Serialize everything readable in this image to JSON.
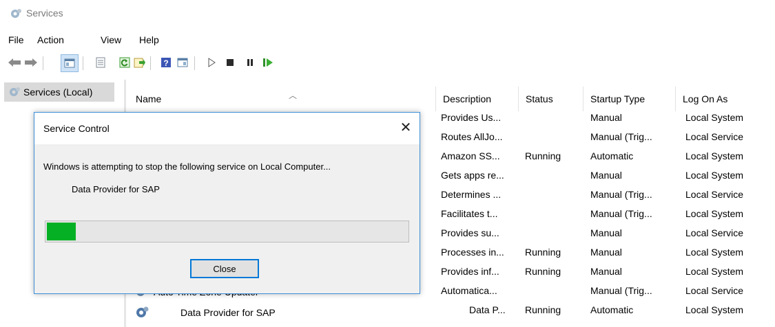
{
  "window": {
    "title": "Services"
  },
  "menu": [
    "File",
    "Action",
    "View",
    "Help"
  ],
  "tree": {
    "selected_label": "Services (Local)"
  },
  "columns": {
    "name": "Name",
    "description": "Description",
    "status": "Status",
    "startup": "Startup Type",
    "logon": "Log On As"
  },
  "rows": [
    {
      "description": "Provides Us...",
      "status": "",
      "startup": "Manual",
      "logon": "Local System"
    },
    {
      "description": "Routes AllJo...",
      "status": "",
      "startup": "Manual (Trig...",
      "logon": "Local Service"
    },
    {
      "description": "Amazon SS...",
      "status": "Running",
      "startup": "Automatic",
      "logon": "Local System"
    },
    {
      "description": "Gets apps re...",
      "status": "",
      "startup": "Manual",
      "logon": "Local System"
    },
    {
      "description": "Determines ...",
      "status": "",
      "startup": "Manual (Trig...",
      "logon": "Local Service"
    },
    {
      "description": "Facilitates t...",
      "status": "",
      "startup": "Manual (Trig...",
      "logon": "Local System"
    },
    {
      "description": "Provides su...",
      "status": "",
      "startup": "Manual",
      "logon": "Local Service"
    },
    {
      "description": "Processes in...",
      "status": "Running",
      "startup": "Manual",
      "logon": "Local System"
    },
    {
      "description": "Provides inf...",
      "status": "Running",
      "startup": "Manual",
      "logon": "Local System"
    },
    {
      "name": "Auto Time Zone Updater",
      "description": "Automatica...",
      "status": "",
      "startup": "Manual (Trig...",
      "logon": "Local Service"
    },
    {
      "name": "Data Provider for SAP",
      "description": "Data P...",
      "status": "Running",
      "startup": "Automatic",
      "logon": "Local System"
    }
  ],
  "dialog": {
    "title": "Service Control",
    "message": "Windows is attempting to stop the following service on Local Computer...",
    "service_name": "Data Provider for SAP",
    "progress": 0.08,
    "close_button": "Close",
    "close_glyph": "✕"
  },
  "colors": {
    "progress_fill": "#06b025",
    "dialog_border": "#3c8ed8",
    "focus_border": "#0078d7"
  },
  "icons": [
    "gear-icon",
    "back-arrow-icon",
    "forward-arrow-icon",
    "play-icon",
    "stop-icon",
    "pause-icon",
    "resume-icon",
    "help-icon",
    "refresh-icon",
    "export-icon"
  ]
}
